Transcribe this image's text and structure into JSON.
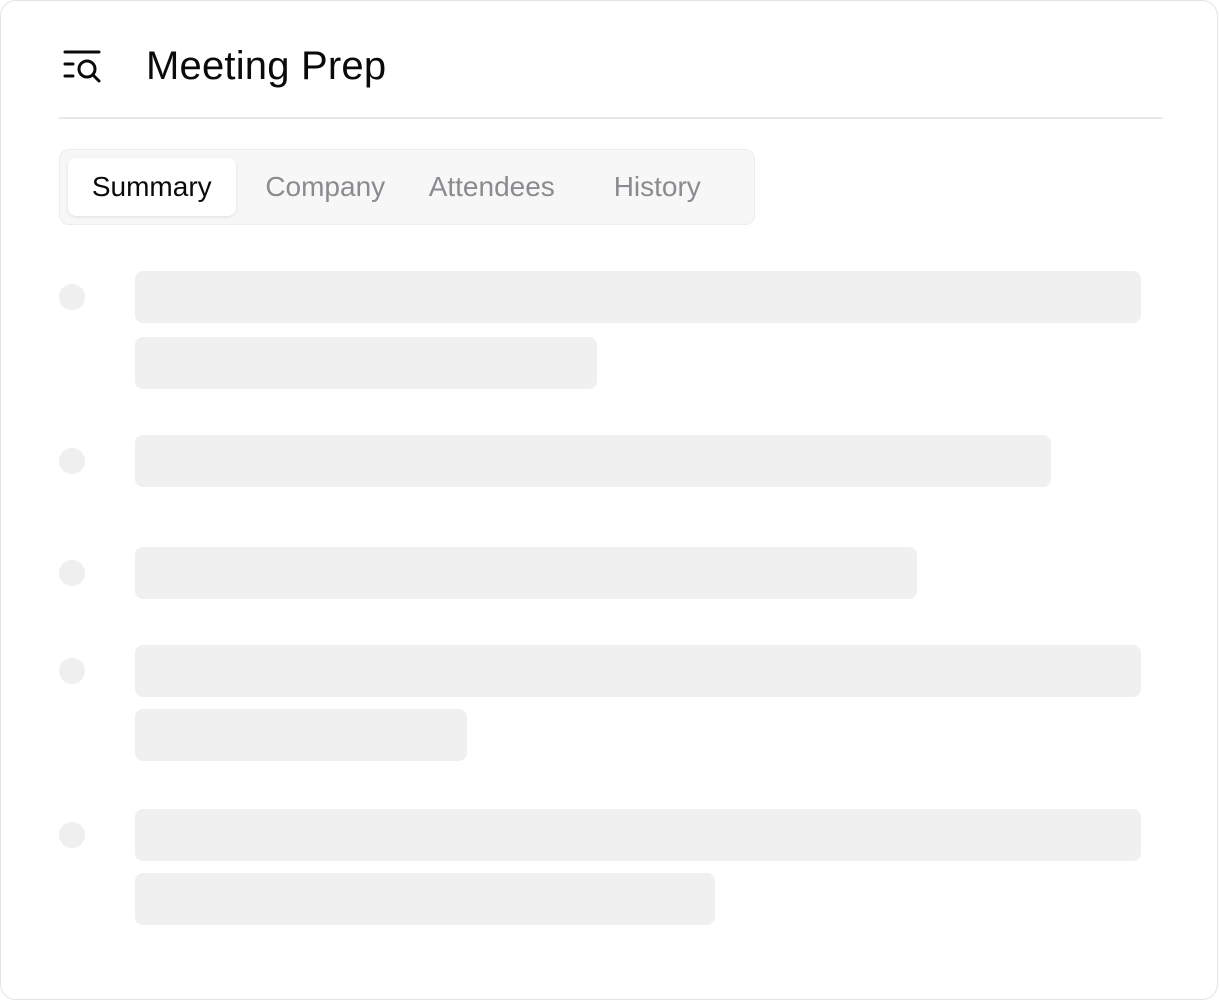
{
  "header": {
    "title": "Meeting Prep",
    "icon": "list-search-icon"
  },
  "tabs": [
    {
      "label": "Summary",
      "active": true
    },
    {
      "label": "Company",
      "active": false
    },
    {
      "label": "Attendees",
      "active": false
    },
    {
      "label": "History",
      "active": false
    }
  ],
  "content": {
    "state": "loading",
    "skeleton_items": 5
  },
  "colors": {
    "title": "#0a0a0a",
    "tab_inactive": "#8b8b8f",
    "skeleton": "#f0f0f0",
    "tabs_background": "#f8f7f8"
  }
}
